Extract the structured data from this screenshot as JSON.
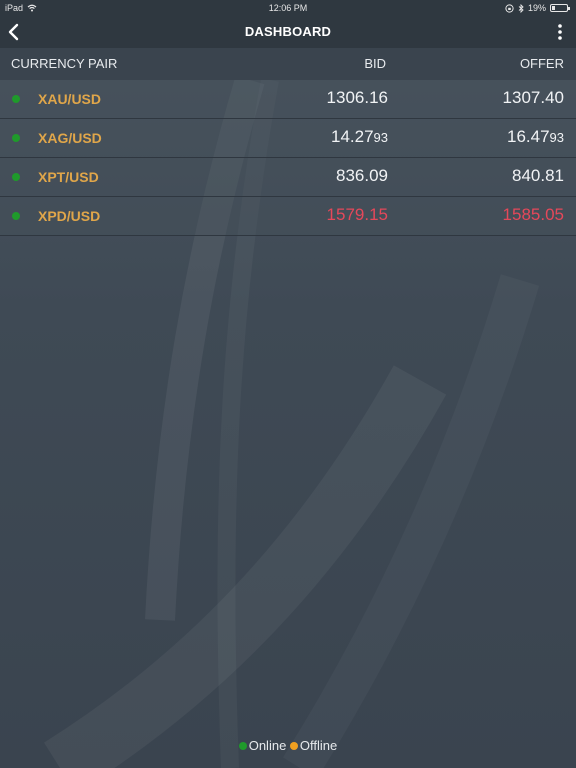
{
  "status_bar": {
    "device": "iPad",
    "time": "12:06 PM",
    "battery": "19%"
  },
  "nav": {
    "title": "DASHBOARD"
  },
  "table": {
    "headers": {
      "pair": "CURRENCY PAIR",
      "bid": "BID",
      "offer": "OFFER"
    },
    "rows": [
      {
        "pair": "XAU/USD",
        "bid_main": "1306.",
        "bid_tail": "16",
        "offer_main": "1307.",
        "offer_tail": "40",
        "status": "online",
        "price_color": "white"
      },
      {
        "pair": "XAG/USD",
        "bid_main": "14.27",
        "bid_tail": "93",
        "offer_main": "16.47",
        "offer_tail": "93",
        "status": "online",
        "price_color": "white"
      },
      {
        "pair": "XPT/USD",
        "bid_main": "836.",
        "bid_tail": "09",
        "offer_main": "840.",
        "offer_tail": "81",
        "status": "online",
        "price_color": "white"
      },
      {
        "pair": "XPD/USD",
        "bid_main": "1579.",
        "bid_tail": "15",
        "offer_main": "1585.",
        "offer_tail": "05",
        "status": "online",
        "price_color": "red"
      }
    ]
  },
  "legend": {
    "online_label": "Online",
    "offline_label": "Offline"
  },
  "colors": {
    "online": "#1f9a2b",
    "offline": "#f0a020",
    "pair_text": "#e0a64a",
    "price_down": "#e5485a"
  },
  "icons": {
    "back": "chevron-left-icon",
    "menu": "more-vertical-icon",
    "wifi": "wifi-icon",
    "bluetooth": "bluetooth-icon",
    "orientation_lock": "orientation-lock-icon",
    "battery": "battery-icon"
  }
}
